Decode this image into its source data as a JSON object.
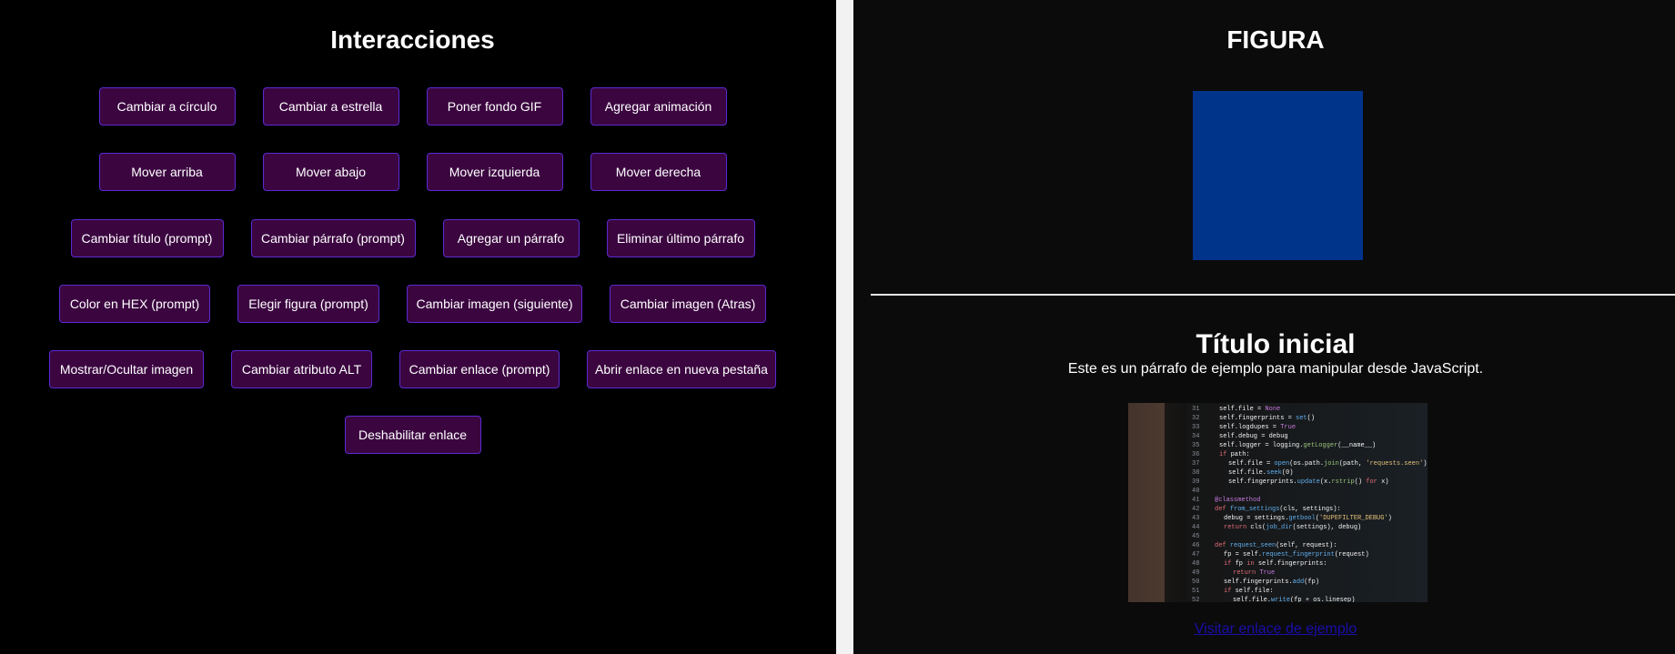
{
  "interactions": {
    "title": "Interacciones",
    "rows": [
      [
        "Cambiar a círculo",
        "Cambiar a estrella",
        "Poner fondo GIF",
        "Agregar animación"
      ],
      [
        "Mover arriba",
        "Mover abajo",
        "Mover izquierda",
        "Mover derecha"
      ],
      [
        "Cambiar título (prompt)",
        "Cambiar párrafo (prompt)",
        "Agregar un párrafo",
        "Eliminar último párrafo"
      ],
      [
        "Color en HEX (prompt)",
        "Elegir figura (prompt)",
        "Cambiar imagen (siguiente)",
        "Cambiar imagen (Atras)"
      ],
      [
        "Mostrar/Ocultar imagen",
        "Cambiar atributo ALT",
        "Cambiar enlace (prompt)",
        "Abrir enlace en nueva pestaña"
      ],
      [
        "Deshabilitar enlace"
      ]
    ]
  },
  "figure": {
    "title": "FIGURA",
    "shape_color": "#00338a"
  },
  "content": {
    "title": "Título inicial",
    "paragraph": "Este es un párrafo de ejemplo para manipular desde JavaScript.",
    "link_text": "Visitar enlace de ejemplo"
  },
  "colors": {
    "button_bg": "#3b0640",
    "button_border": "#5a2ad0",
    "link": "#1a0dab"
  }
}
